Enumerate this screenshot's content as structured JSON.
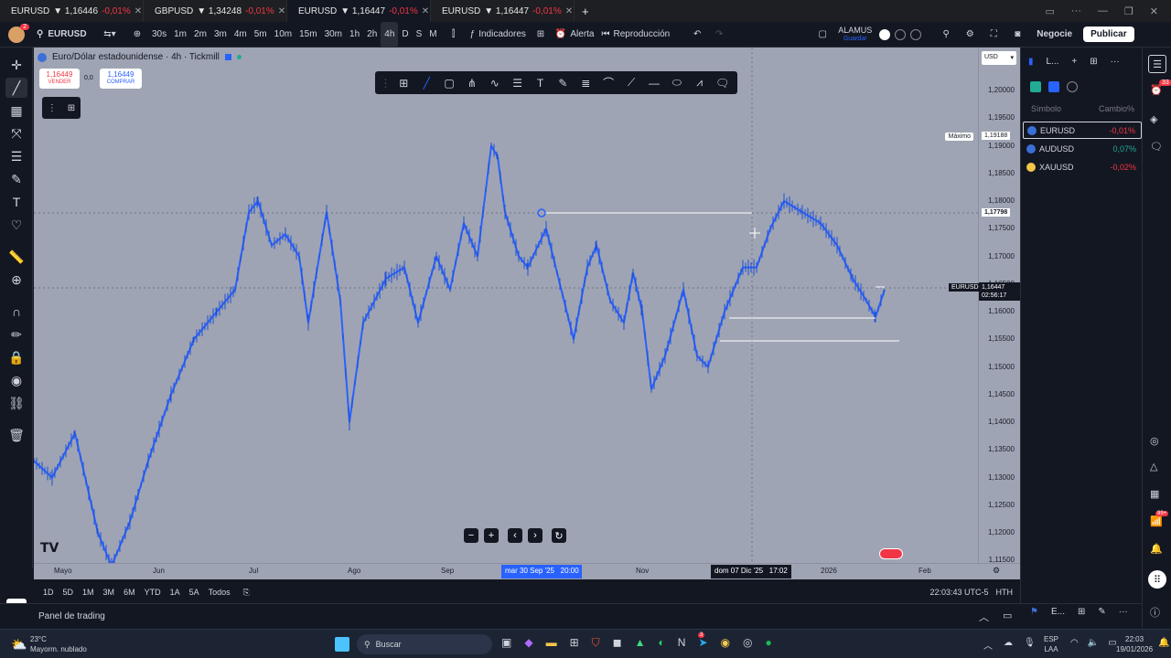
{
  "tabs": [
    {
      "symbol": "EURUSD",
      "price": "▼ 1,16446",
      "change": "-0,01%"
    },
    {
      "symbol": "GBPUSD",
      "price": "▼ 1,34248",
      "change": "-0,01%"
    },
    {
      "symbol": "EURUSD",
      "price": "▼ 1,16447",
      "change": "-0,01%"
    },
    {
      "symbol": "EURUSD",
      "price": "▼ 1,16447",
      "change": "-0,01%"
    }
  ],
  "toolbar": {
    "symbol": "EURUSD",
    "intervals": [
      "30s",
      "1m",
      "2m",
      "3m",
      "4m",
      "5m",
      "10m",
      "15m",
      "30m",
      "1h",
      "2h",
      "4h",
      "D",
      "S",
      "M"
    ],
    "active_interval": "4h",
    "indicators_label": "Indicadores",
    "alert_label": "Alerta",
    "replay_label": "Reproducción",
    "account_name": "ALAMUS",
    "account_sub": "Guardar",
    "trade_label": "Negocie",
    "publish_label": "Publicar",
    "avatar_badge": "2"
  },
  "chart": {
    "title": "Euro/Dólar estadounidense · 4h · Tickmill",
    "sell_price": "1,16449",
    "sell_label": "VENDER",
    "spread": "0,0",
    "buy_price": "1,16449",
    "buy_label": "COMPRAR",
    "currency": "USD",
    "max_label": "Máximo",
    "max_value": "1,19188",
    "line_value": "1,17798",
    "current_symbol": "EURUSD",
    "current_price": "1,16447",
    "countdown": "02:56:17",
    "price_ticks": [
      "1,20000",
      "1,19500",
      "1,19000",
      "1,18500",
      "1,18000",
      "1,17500",
      "1,17000",
      "1,16500",
      "1,16000",
      "1,15500",
      "1,15000",
      "1,14500",
      "1,14000",
      "1,13500",
      "1,13000",
      "1,12500",
      "1,12000",
      "1,11500"
    ],
    "time_ticks": [
      "Mayo",
      "Jun",
      "Jul",
      "Ago",
      "Sep",
      "Nov",
      "2026",
      "Feb"
    ],
    "cursor_time_1": "mar 30 Sep '25   20:00",
    "cursor_time_2": "dom 07 Dic '25   17:02",
    "logo": "TV"
  },
  "bottom": {
    "ranges": [
      "1D",
      "5D",
      "1M",
      "3M",
      "6M",
      "YTD",
      "1A",
      "5A",
      "Todos"
    ],
    "clock": "22:03:43 UTC-5",
    "hth": "HTH"
  },
  "panel": {
    "trading_panel": "Panel de trading",
    "watchlist_title": "L...",
    "col_symbol": "Símbolo",
    "col_change": "Cambio%",
    "watchlist": [
      {
        "symbol": "EURUSD",
        "change": "-0,01%",
        "color": "#f23645"
      },
      {
        "symbol": "AUDUSD",
        "change": "0,07%",
        "color": "#22ab94"
      },
      {
        "symbol": "XAUUSD",
        "change": "-0,02%",
        "color": "#f23645"
      }
    ],
    "bottom_label": "E..."
  },
  "strip_badges": {
    "first": "33",
    "second": "99+"
  },
  "taskbar": {
    "temp": "23°C",
    "weather": "Mayorm. nublado",
    "search": "Buscar",
    "lang_1": "ESP",
    "lang_2": "LAA",
    "time": "22:03",
    "date": "19/01/2026",
    "badge": "3"
  },
  "colors": {
    "chart_bg": "#9ea4b3",
    "candle": "#2962ff",
    "dark": "#131722",
    "red": "#f23645",
    "green": "#22ab94"
  }
}
